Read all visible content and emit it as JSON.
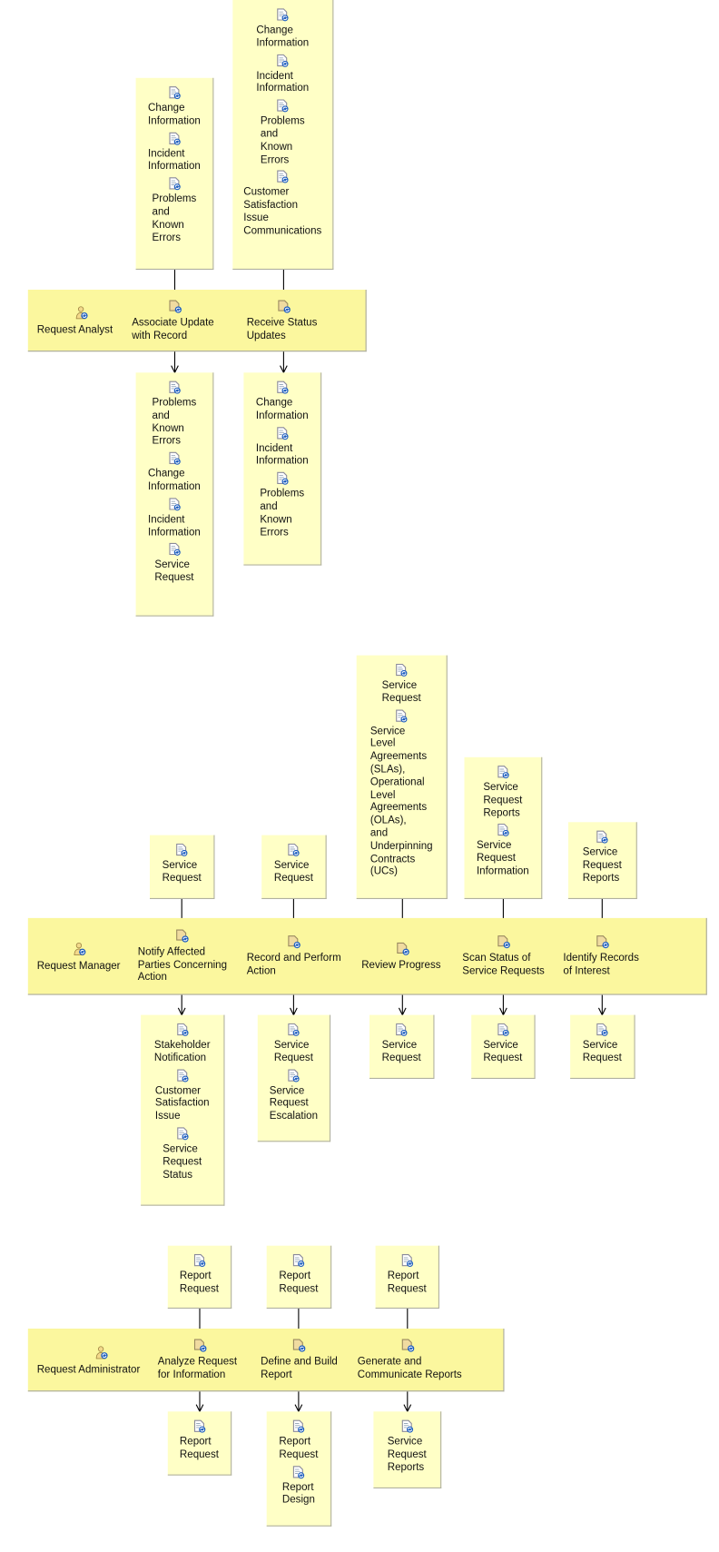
{
  "colors": {
    "lane": "#fbf79e",
    "artifact": "#ffffc6",
    "arrow": "#000000",
    "sync": "#1f5fbf"
  },
  "icons": {
    "role": "role-person-icon",
    "task": "task-icon",
    "artifact": "work-product-icon"
  },
  "lanes": [
    {
      "role": "Request Analyst",
      "tasks": [
        {
          "label": "Associate Update\nwith Record",
          "inputs": [
            "Change\nInformation",
            "Incident\nInformation",
            "Problems\nand\nKnown\nErrors"
          ],
          "outputs": [
            "Problems\nand\nKnown\nErrors",
            "Change\nInformation",
            "Incident\nInformation",
            "Service\nRequest"
          ]
        },
        {
          "label": "Receive Status\nUpdates",
          "inputs": [
            "Change\nInformation",
            "Incident\nInformation",
            "Problems\nand\nKnown\nErrors",
            "Customer\nSatisfaction\nIssue\nCommunications"
          ],
          "outputs": [
            "Change\nInformation",
            "Incident\nInformation",
            "Problems\nand\nKnown\nErrors"
          ]
        }
      ]
    },
    {
      "role": "Request Manager",
      "tasks": [
        {
          "label": "Notify Affected\nParties Concerning\nAction",
          "inputs": [
            "Service\nRequest"
          ],
          "outputs": [
            "Stakeholder\nNotification",
            "Customer\nSatisfaction\nIssue",
            "Service\nRequest\nStatus"
          ]
        },
        {
          "label": "Record and Perform\nAction",
          "inputs": [
            "Service\nRequest"
          ],
          "outputs": [
            "Service\nRequest",
            "Service\nRequest\nEscalation"
          ]
        },
        {
          "label": "Review Progress",
          "inputs": [
            "Service\nRequest",
            "Service\nLevel\nAgreements\n(SLAs),\nOperational\nLevel\nAgreements\n(OLAs),\nand\nUnderpinning\nContracts\n(UCs)"
          ],
          "outputs": [
            "Service\nRequest"
          ]
        },
        {
          "label": "Scan Status of\nService Requests",
          "inputs": [
            "Service\nRequest\nReports",
            "Service\nRequest\nInformation"
          ],
          "outputs": [
            "Service\nRequest"
          ]
        },
        {
          "label": "Identify Records\nof Interest",
          "inputs": [
            "Service\nRequest\nReports"
          ],
          "outputs": [
            "Service\nRequest"
          ]
        }
      ]
    },
    {
      "role": "Request Administrator",
      "tasks": [
        {
          "label": "Analyze Request\nfor Information",
          "inputs": [
            "Report\nRequest"
          ],
          "outputs": [
            "Report\nRequest"
          ]
        },
        {
          "label": "Define and Build\nReport",
          "inputs": [
            "Report\nRequest"
          ],
          "outputs": [
            "Report\nRequest",
            "Report\nDesign"
          ]
        },
        {
          "label": "Generate and\nCommunicate Reports",
          "inputs": [
            "Report\nRequest"
          ],
          "outputs": [
            "Service\nRequest\nReports"
          ]
        }
      ]
    }
  ]
}
